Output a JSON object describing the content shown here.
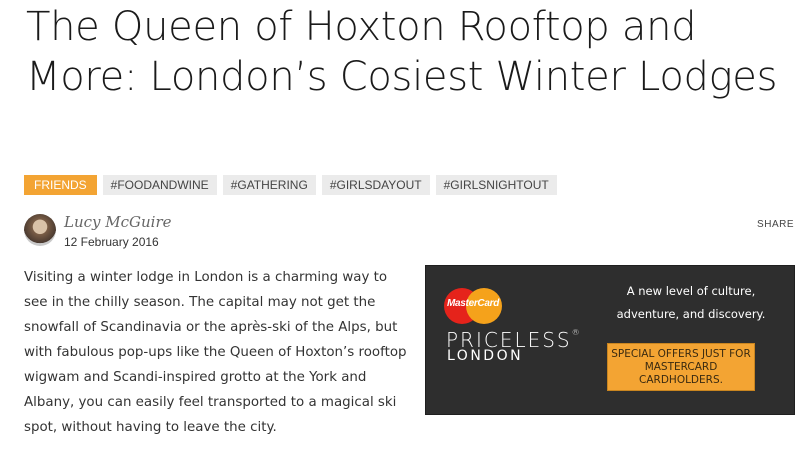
{
  "article": {
    "title": "The Queen of Hoxton Rooftop and More: London’s Cosiest Winter Lodges",
    "tags": [
      "FRIENDS",
      "#FOODANDWINE",
      "#GATHERING",
      "#GIRLSDAYOUT",
      "#GIRLSNIGHTOUT"
    ],
    "author": {
      "name": "Lucy McGuire",
      "date": "12 February 2016"
    },
    "share_label": "SHARE",
    "body": "Visiting a winter lodge in London is a charming way to see in the chilly season. The capital may not get the snowfall of Scandinavia or the après-ski of the Alps, but with fabulous pop-ups like the Queen of Hoxton’s rooftop wigwam and Scandi-inspired grotto at the York and Albany, you can easily feel transported to a magical ski spot, without having to leave the city."
  },
  "ad": {
    "brand": "MasterCard",
    "priceless": "PRICELESS",
    "registered": "®",
    "city": "LONDON",
    "tagline": "A new level of culture, adventure, and discovery.",
    "offer": "SPECIAL OFFERS JUST FOR MASTERCARD CARDHOLDERS."
  },
  "colors": {
    "tag_primary": "#f3a433",
    "tag_default": "#ebebeb",
    "ad_background": "#2e2e2e",
    "mastercard_red": "#e5231b",
    "mastercard_yellow": "#f5a21b"
  }
}
